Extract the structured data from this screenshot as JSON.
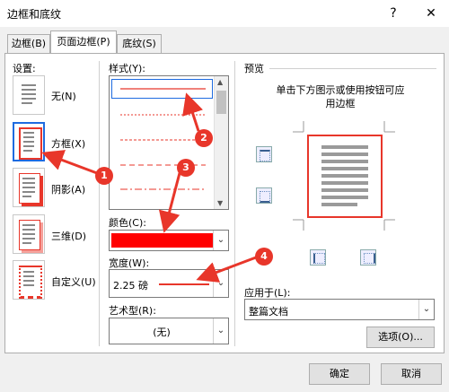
{
  "window": {
    "title": "边框和底纹",
    "help_label": "?",
    "close_label": "✕"
  },
  "tabs": [
    {
      "label": "边框(B)"
    },
    {
      "label": "页面边框(P)"
    },
    {
      "label": "底纹(S)"
    }
  ],
  "settings": {
    "heading": "设置:",
    "items": [
      {
        "label": "无(N)"
      },
      {
        "label": "方框(X)"
      },
      {
        "label": "阴影(A)"
      },
      {
        "label": "三维(D)"
      },
      {
        "label": "自定义(U)"
      }
    ]
  },
  "style": {
    "label": "样式(Y):"
  },
  "color": {
    "label": "颜色(C):",
    "value_color": "#ff0000"
  },
  "width": {
    "label": "宽度(W):",
    "value": "2.25 磅"
  },
  "art": {
    "label": "艺术型(R):",
    "value": "(无)"
  },
  "preview": {
    "heading": "预览",
    "hint_line1": "单击下方图示或使用按钮可应",
    "hint_line2": "用边框",
    "border_color": "#e8362a"
  },
  "apply_to": {
    "label": "应用于(L):",
    "value": "整篇文档"
  },
  "options_button": "选项(O)...",
  "ok_button": "确定",
  "cancel_button": "取消",
  "callouts": [
    "1",
    "2",
    "3",
    "4"
  ],
  "accent_red": "#e8362a"
}
